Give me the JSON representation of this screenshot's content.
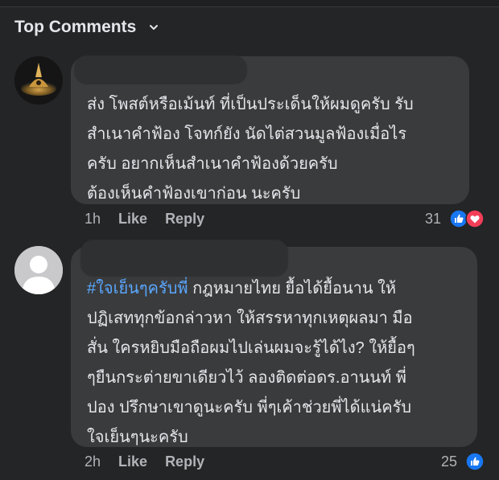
{
  "header": {
    "title": "Top Comments"
  },
  "comments": [
    {
      "text": "ส่ง โพสต์หรือเม้นท์ ที่เป็นประเด็นให้ผมดูครับ รับ\nสำเนาคำฟ้อง โจทก์ยัง นัดไต่สวนมูลฟ้องเมื่อไร\nครับ อยากเห็นสำเนาคำฟ้องด้วยครับ\nต้องเห็นคำฟ้องเขาก่อน นะครับ",
      "time": "1h",
      "like_label": "Like",
      "reply_label": "Reply",
      "reaction_count": "31",
      "reactions": [
        "like-icon",
        "love-icon"
      ]
    },
    {
      "hashtag": "#ใจเย็นๆครับพี่",
      "text": " กฎหมายไทย ยื้อได้ยื้อนาน ให้\nปฏิเสททุกข้อกล่าวหา ให้สรรหาทุกเหตุผลมา มือ\nสั่น ใครหยิบมือถือผมไปเล่นผมจะรู้ได้ไง? ให้ยื้อๆ\nๆยืนกระต่ายขาเดียวไว้ ลองติดต่อดร.อานนท์ พี่\nปอง ปรึกษาเขาดูนะครับ พี่ๆเค้าช่วยพี่ได้แน่ครับ\nใจเย็นๆนะครับ",
      "time": "2h",
      "like_label": "Like",
      "reply_label": "Reply",
      "reaction_count": "25",
      "reactions": [
        "like-icon"
      ]
    }
  ],
  "colors": {
    "background": "#242526",
    "bubble": "#3a3b3c",
    "text": "#e4e6eb",
    "muted": "#b0b3b8",
    "hashtag": "#5aa7ff",
    "like_blue": "#1877f2",
    "love_red": "#f33e58"
  }
}
